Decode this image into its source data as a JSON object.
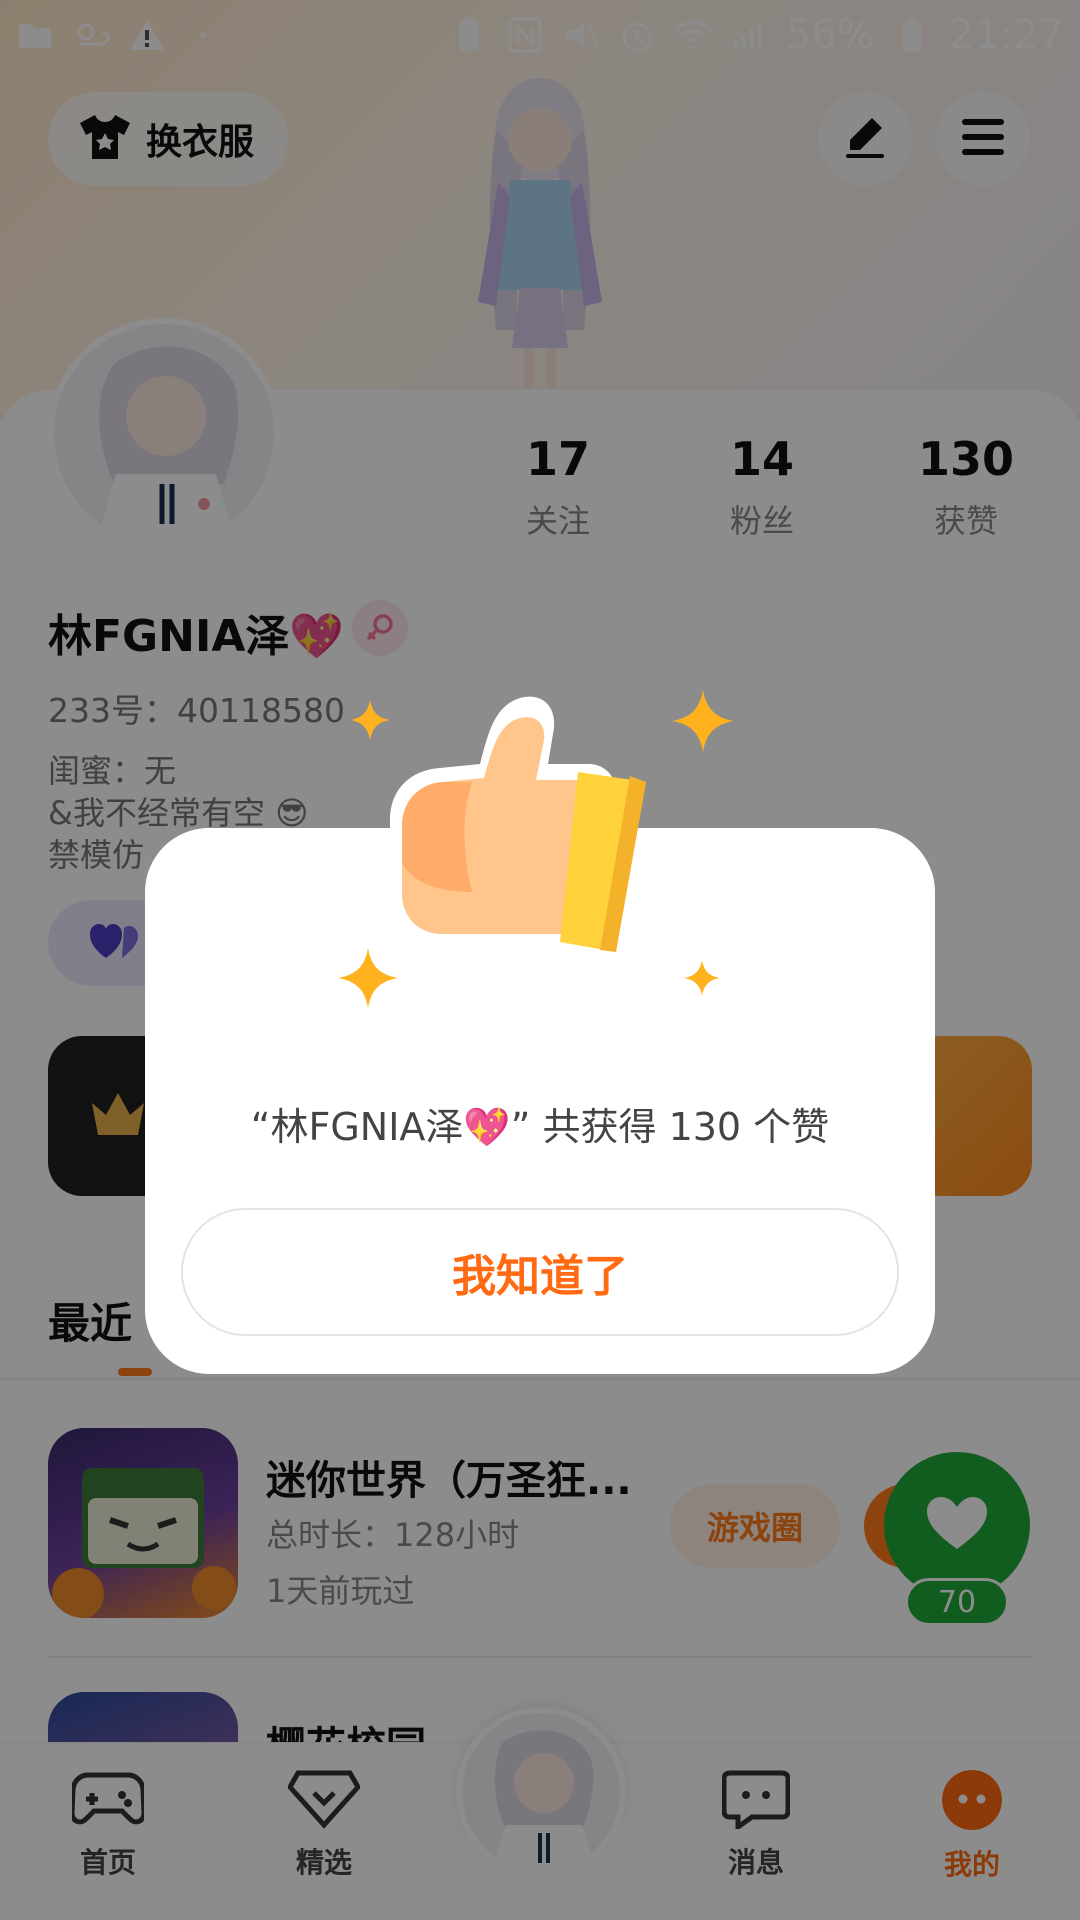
{
  "status_bar": {
    "battery_percent": "56%",
    "time": "21:27"
  },
  "header": {
    "outfit_button_label": "换衣服"
  },
  "profile": {
    "stats": [
      {
        "value": "17",
        "label": "关注"
      },
      {
        "value": "14",
        "label": "粉丝"
      },
      {
        "value": "130",
        "label": "获赞"
      }
    ],
    "username": "林FGNIA泽💖",
    "uid_label": "233号：40118580",
    "bio_lines": [
      "闺蜜：无",
      "&我不经常有空 😎",
      "禁模仿"
    ]
  },
  "section": {
    "title": "最近"
  },
  "games": [
    {
      "title": "迷你世界（万圣狂...",
      "duration": "总时长：128小时",
      "last_played": "1天前玩过",
      "circle_button": "游戏圈"
    },
    {
      "title": "樱花校园"
    }
  ],
  "like_fab": {
    "count": "70"
  },
  "bottom_nav": {
    "items": [
      {
        "label": "首页"
      },
      {
        "label": "精选"
      },
      {
        "label": "消息"
      },
      {
        "label": "我的"
      }
    ]
  },
  "modal": {
    "message": "“林FGNIA泽💖” 共获得 130 个赞",
    "confirm_label": "我知道了"
  },
  "colors": {
    "accent": "#ff6a13",
    "like_green": "#1fa83a",
    "sparkle": "#ffb21e"
  }
}
